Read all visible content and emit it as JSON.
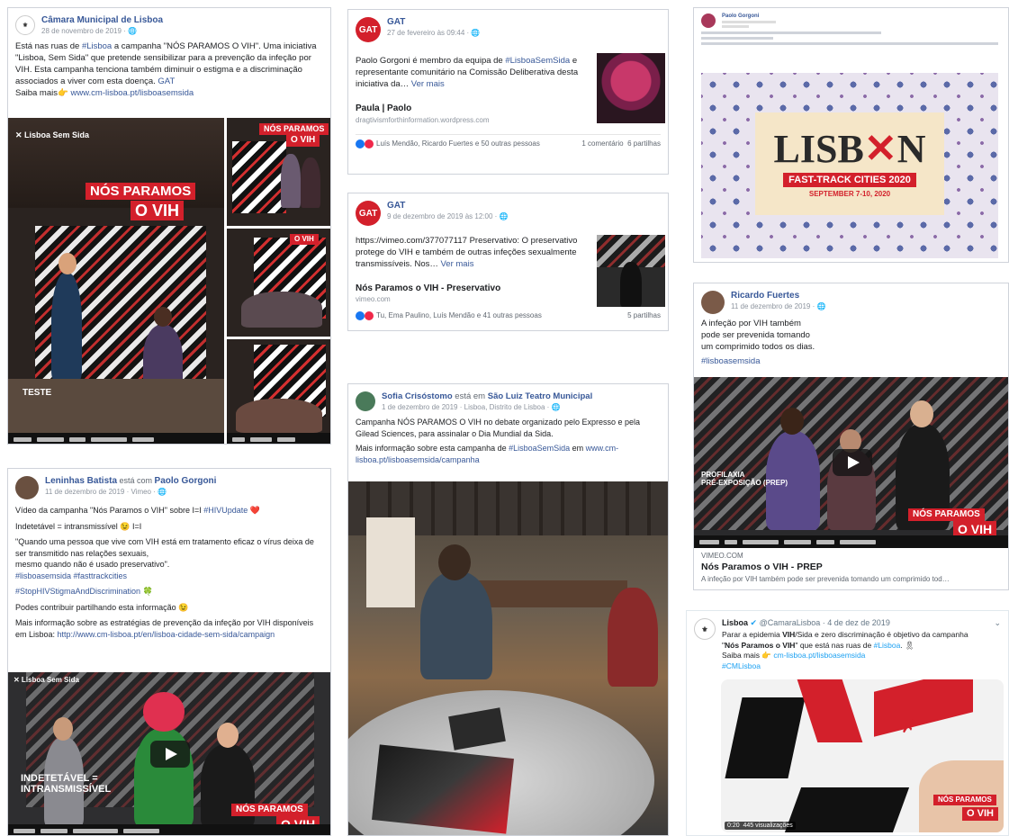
{
  "p1": {
    "author": "Câmara Municipal de Lisboa",
    "date": "28 de novembro de 2019 · ",
    "text1": "Está nas ruas de ",
    "hashtag": "#Lisboa",
    "text2": " a campanha \"NÓS PARAMOS O VIH\". Uma iniciativa \"Lisboa, Sem Sida\" que pretende sensibilizar para a prevenção da infeção por VIH. Esta campanha tenciona também diminuir o estigma e a discriminação associados a viver com esta doença. ",
    "gat": "GAT",
    "more": "Saiba mais👉 ",
    "url": "www.cm-lisboa.pt/lisboasemsida",
    "banner1": "NÓS PARAMOS",
    "banner2": "O VIH",
    "test": "TESTE"
  },
  "p2": {
    "author": "GAT",
    "date": "27 de fevereiro às 09:44 · ",
    "text1": "Paolo Gorgoni é membro da equipa de ",
    "hashtag": "#LisboaSemSida",
    "text2": " e representante comunitário na Comissão Deliberativa desta iniciativa da… ",
    "more": "Ver mais",
    "link_title": "Paula | Paolo",
    "link_url": "dragtivismforthinformation.wordpress.com",
    "reactions": "Luís Mendão, Ricardo Fuertes e 50 outras pessoas",
    "comments": "1 comentário",
    "shares": "6 partilhas"
  },
  "p3": {
    "author": "GAT",
    "date": "9 de dezembro de 2019 às 12:00 · ",
    "text": "https://vimeo.com/377077117 Preservativo: O preservativo protege do VIH e também de outras infeções sexualmente transmissíveis. Nos… ",
    "more": "Ver mais",
    "link_title": "Nós Paramos o VIH - Preservativo",
    "link_url": "vimeo.com",
    "reactions": "Tu, Ema Paulino, Luís Mendão e 41 outras pessoas",
    "shares": "5 partilhas"
  },
  "p4": {
    "author": "Paolo Gorgoni",
    "logo1": "LISB",
    "logo2": "N",
    "sub": "FAST-TRACK CITIES 2020",
    "dates": "SEPTEMBER 7-10, 2020"
  },
  "p5": {
    "author": "Ricardo Fuertes",
    "date": "11 de dezembro de 2019 · ",
    "l1": "A infeção por VIH também",
    "l2": "pode ser prevenida tomando",
    "l3": "um comprimido todos os dias.",
    "hashtag": "#lisboasemsida",
    "src": "VIMEO.COM",
    "title": "Nós Paramos o VIH - PREP",
    "desc": "A infeção por VIH também pode ser prevenida tomando um comprimido tod…",
    "video_line1": "PROFILAXIA",
    "video_line2": "PRÉ-EXPOSIÇÃO (PREP)",
    "banner1": "NÓS PARAMOS",
    "banner2": "O VIH"
  },
  "p6": {
    "author": "Leninhas Batista",
    "with": " está com ",
    "tag": "Paolo Gorgoni",
    "date": "11 de dezembro de 2019 · Vimeo · ",
    "l1a": "Vídeo da campanha \"Nós Paramos o VIH\" sobre I=I ",
    "l1b": "#HIVUpdate",
    "l1c": " ❤️",
    "l2": "Indetetável = intransmissível 😉 I=I",
    "l3": "\"Quando uma pessoa que vive com VIH está em tratamento eficaz o vírus deixa de ser transmitido nas relações sexuais,",
    "l4": "mesmo quando não é usado preservativo\".",
    "l5": "#lisboasemsida #fasttrackcities",
    "l6": "#StopHIVStigmaAndDiscrimination 🍀",
    "l7": "Podes contribuir partilhando esta informação 😉",
    "l8": "Mais informação sobre as estratégias de prevenção da infeção por VIH disponíveis em Lisboa: ",
    "url": "http://www.cm-lisboa.pt/en/lisboa-cidade-sem-sida/campaign",
    "video_line1": "INDETETÁVEL =",
    "video_line2": "INTRANSMISSÍVEL",
    "banner1": "NÓS PARAMOS",
    "banner2": "O VIH"
  },
  "p7": {
    "author": "Sofia Crisóstomo",
    "at": " está em ",
    "place": "São Luiz Teatro Municipal",
    "date": "1 de dezembro de 2019 · Lisboa, Distrito de Lisboa · ",
    "text": "Campanha NÓS PARAMOS O VIH no debate organizado pelo Expresso e pela Gilead Sciences, para assinalar o Dia Mundial da Sida.",
    "more1": "Mais informação sobre esta campanha de ",
    "hashtag": "#LisboaSemSida",
    "more2": " em ",
    "url": "www.cm-lisboa.pt/lisboasemsida/campanha"
  },
  "p8": {
    "author": "Lisboa",
    "handle": "@CamaraLisboa · 4 de dez de 2019",
    "t1": "Parar a epidemia ",
    "t1b": "VIH",
    "t1c": "/Sida e zero discriminação é objetivo da campanha",
    "t2a": "\"",
    "t2b": "Nós Paramos o VIH",
    "t2c": "\" que está nas ruas de ",
    "t2d": "#Lisboa",
    "t2e": ". 🎗",
    "t3a": "Saiba mais 👉 ",
    "t3b": "cm-lisboa.pt/lisboasemsida",
    "t4": "#CMLisboa",
    "time": "0:20",
    "views": "445 visualizações",
    "banner1": "NÓS PARAMOS",
    "banner2": "O VIH"
  }
}
